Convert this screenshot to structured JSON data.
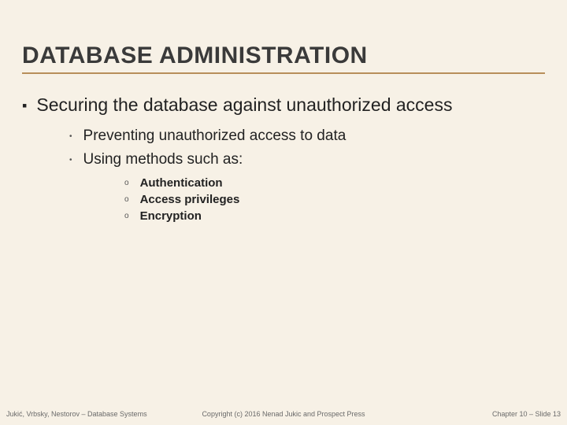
{
  "title": "DATABASE ADMINISTRATION",
  "main_bullet": "Securing the database against unauthorized access",
  "sub_bullets": [
    "Preventing unauthorized access to data",
    "Using methods such as:"
  ],
  "sub2_bullets": [
    "Authentication",
    "Access privileges",
    "Encryption"
  ],
  "footer": {
    "left": "Jukić, Vrbsky, Nestorov – Database Systems",
    "center": "Copyright (c) 2016 Nenad Jukic and Prospect Press",
    "right": "Chapter 10 – Slide 13"
  }
}
